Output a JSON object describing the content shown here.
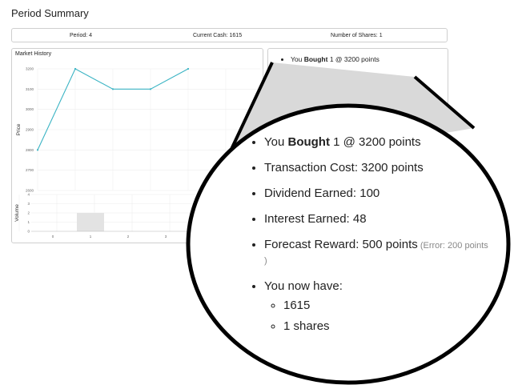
{
  "page": {
    "title": "Period Summary"
  },
  "stats": {
    "period": "Period: 4",
    "cash": "Current Cash: 1615",
    "shares": "Number of Shares: 1"
  },
  "chart_data": {
    "type": "line",
    "title": "Market History",
    "price": {
      "ylabel": "Price",
      "ylim": [
        2600,
        3200
      ],
      "yticks": [
        "3200",
        "3100",
        "3000",
        "2900",
        "2800",
        "2700",
        "2600"
      ],
      "x": [
        0,
        1,
        2,
        3,
        4
      ],
      "values": [
        2800,
        3200,
        3100,
        3100,
        3200
      ],
      "line_color": "#3bb4c4"
    },
    "volume": {
      "ylabel": "Volume",
      "ylim": [
        0,
        4
      ],
      "yticks": [
        "4",
        "3",
        "2",
        "1",
        "0"
      ],
      "x": [
        0,
        1,
        2,
        3,
        4
      ],
      "values": [
        0,
        2,
        0,
        0,
        0
      ],
      "bar_color": "#e3e3e3"
    },
    "xticks": [
      "0",
      "1",
      "2",
      "3"
    ],
    "grid": true
  },
  "summary": {
    "trade_prefix": "You ",
    "trade_action": "Bought",
    "trade_rest": " 1 @ 3200 points",
    "transaction_cost": "Transaction Cost: 3200 points",
    "dividend": "Dividend Earned: 100"
  },
  "magnified": {
    "trade_prefix": "You ",
    "trade_action": "Bought",
    "trade_rest": " 1 @ 3200 points",
    "transaction_cost": "Transaction Cost: 3200 points",
    "dividend": "Dividend Earned: 100",
    "interest": "Interest Earned: 48",
    "forecast": "Forecast Reward: 500 points",
    "forecast_error": " (Error: 200 points )",
    "now_have": "You now have:",
    "cash_value": "1615",
    "shares_value": "1 shares"
  }
}
